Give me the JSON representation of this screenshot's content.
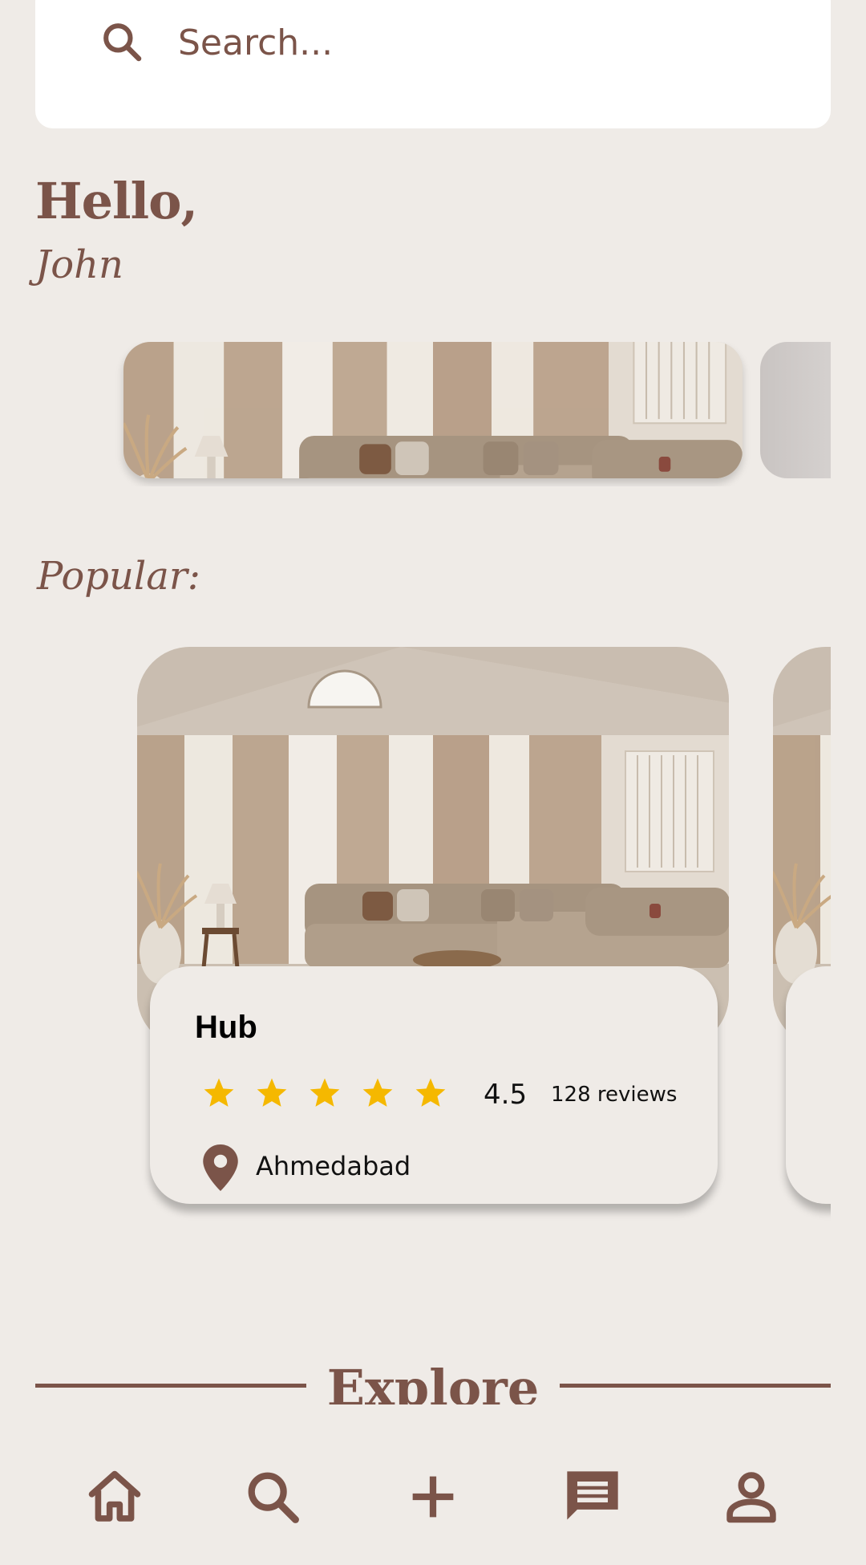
{
  "search": {
    "placeholder": "Search..."
  },
  "greeting": {
    "hello": "Hello,",
    "name": "John"
  },
  "popular": {
    "heading": "Popular:",
    "items": [
      {
        "title": "Hub",
        "rating": 4.5,
        "rating_text": "4.5",
        "stars": 5,
        "reviews": "128 reviews",
        "location": "Ahmedabad"
      }
    ]
  },
  "explore": {
    "heading": "Explore"
  },
  "nav": {
    "items": [
      {
        "icon": "home-icon"
      },
      {
        "icon": "search-icon"
      },
      {
        "icon": "add-icon"
      },
      {
        "icon": "chat-icon"
      },
      {
        "icon": "profile-icon"
      }
    ]
  },
  "colors": {
    "brand": "#7b5449",
    "background": "#efebe7",
    "star": "#f5b800"
  }
}
